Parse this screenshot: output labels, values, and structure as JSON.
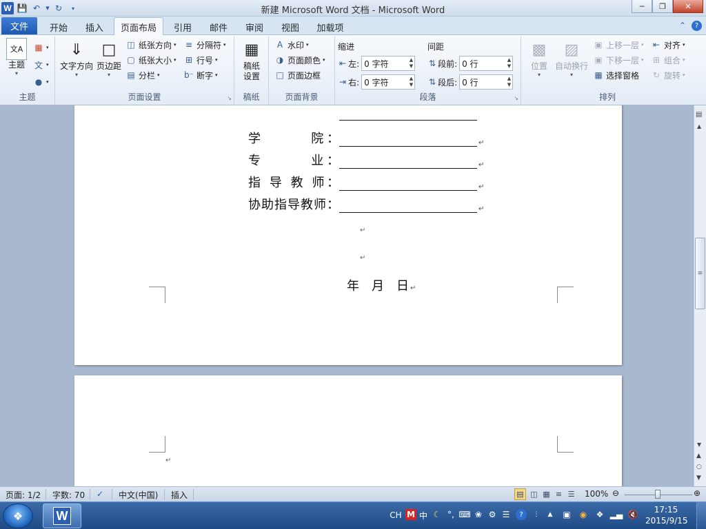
{
  "window": {
    "title": "新建 Microsoft Word 文档 - Microsoft Word"
  },
  "quick_access": {
    "app_icon": "W"
  },
  "tabs": {
    "file": "文件",
    "items": [
      "开始",
      "插入",
      "页面布局",
      "引用",
      "邮件",
      "审阅",
      "视图",
      "加载项"
    ],
    "active": "页面布局"
  },
  "ribbon": {
    "theme": {
      "label": "主题",
      "theme_button": "主题"
    },
    "page_setup": {
      "label": "页面设置",
      "text_direction": "文字方向",
      "margins": "页边距",
      "orientation": "纸张方向",
      "size": "纸张大小",
      "columns": "分栏",
      "breaks": "分隔符",
      "line_numbers": "行号",
      "hyphenation": "断字"
    },
    "manuscript": {
      "label": "稿纸",
      "button_line1": "稿纸",
      "button_line2": "设置"
    },
    "page_background": {
      "label": "页面背景",
      "watermark": "水印",
      "page_color": "页面颜色",
      "page_borders": "页面边框"
    },
    "paragraph": {
      "label": "段落",
      "indent_title": "缩进",
      "spacing_title": "间距",
      "indent_left_label": "左:",
      "indent_left_value": "0 字符",
      "indent_right_label": "右:",
      "indent_right_value": "0 字符",
      "before_label": "段前:",
      "before_value": "0 行",
      "after_label": "段后:",
      "after_value": "0 行"
    },
    "arrange": {
      "label": "排列",
      "position": "位置",
      "wrap_text": "自动换行",
      "bring_forward": "上移一层",
      "send_backward": "下移一层",
      "selection_pane": "选择窗格",
      "align": "对齐",
      "group": "组合",
      "rotate": "旋转"
    }
  },
  "document": {
    "fields": [
      {
        "label": "学　　　院："
      },
      {
        "label": "专　　　业："
      },
      {
        "label": "指 导 教 师："
      },
      {
        "label": "协助指导教师："
      }
    ],
    "date_text": "年　月　日"
  },
  "statusbar": {
    "page": "页面: 1/2",
    "words": "字数: 70",
    "language": "中文(中国)",
    "mode": "插入",
    "zoom": "100%"
  },
  "taskbar": {
    "ime": "CH",
    "ime_mode": "中",
    "time": "17:15",
    "date": "2015/9/15"
  }
}
